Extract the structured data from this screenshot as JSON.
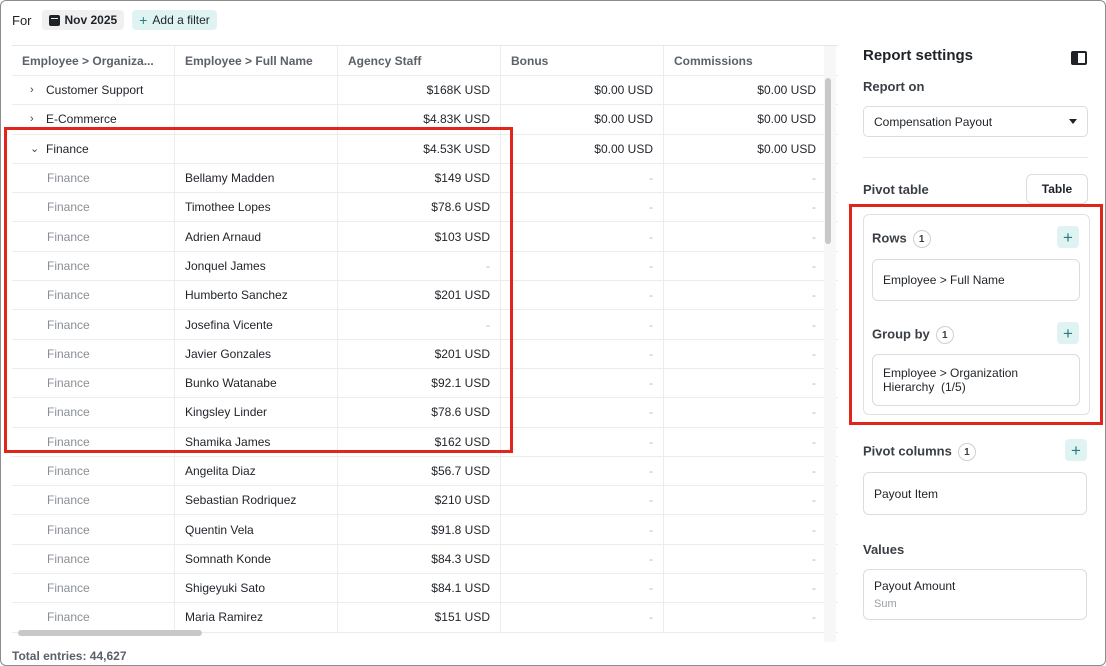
{
  "filter_bar": {
    "for_label": "For",
    "date": "Nov 2025",
    "add_filter": "Add a filter"
  },
  "table": {
    "columns": [
      "Employee > Organiza...",
      "Employee > Full Name",
      "Agency Staff",
      "Bonus",
      "Commissions"
    ],
    "rows": [
      {
        "kind": "group",
        "chevron": "›",
        "org": "Customer Support",
        "name": "",
        "agency": "$168K USD",
        "bonus": "$0.00 USD",
        "commissions": "$0.00 USD"
      },
      {
        "kind": "group",
        "chevron": "›",
        "org": "E-Commerce",
        "name": "",
        "agency": "$4.83K USD",
        "bonus": "$0.00 USD",
        "commissions": "$0.00 USD"
      },
      {
        "kind": "group",
        "chevron": "⌄",
        "org": "Finance",
        "name": "",
        "agency": "$4.53K USD",
        "bonus": "$0.00 USD",
        "commissions": "$0.00 USD"
      },
      {
        "kind": "item",
        "org": "Finance",
        "name": "Bellamy Madden",
        "agency": "$149 USD",
        "bonus": "-",
        "commissions": "-"
      },
      {
        "kind": "item",
        "org": "Finance",
        "name": "Timothee Lopes",
        "agency": "$78.6 USD",
        "bonus": "-",
        "commissions": "-"
      },
      {
        "kind": "item",
        "org": "Finance",
        "name": "Adrien Arnaud",
        "agency": "$103 USD",
        "bonus": "-",
        "commissions": "-"
      },
      {
        "kind": "item",
        "org": "Finance",
        "name": "Jonquel James",
        "agency": "-",
        "bonus": "-",
        "commissions": "-"
      },
      {
        "kind": "item",
        "org": "Finance",
        "name": "Humberto Sanchez",
        "agency": "$201 USD",
        "bonus": "-",
        "commissions": "-"
      },
      {
        "kind": "item",
        "org": "Finance",
        "name": "Josefina Vicente",
        "agency": "-",
        "bonus": "-",
        "commissions": "-"
      },
      {
        "kind": "item",
        "org": "Finance",
        "name": "Javier Gonzales",
        "agency": "$201 USD",
        "bonus": "-",
        "commissions": "-"
      },
      {
        "kind": "item",
        "org": "Finance",
        "name": "Bunko Watanabe",
        "agency": "$92.1 USD",
        "bonus": "-",
        "commissions": "-"
      },
      {
        "kind": "item",
        "org": "Finance",
        "name": "Kingsley Linder",
        "agency": "$78.6 USD",
        "bonus": "-",
        "commissions": "-"
      },
      {
        "kind": "item",
        "org": "Finance",
        "name": "Shamika James",
        "agency": "$162 USD",
        "bonus": "-",
        "commissions": "-"
      },
      {
        "kind": "item",
        "org": "Finance",
        "name": "Angelita Diaz",
        "agency": "$56.7 USD",
        "bonus": "-",
        "commissions": "-"
      },
      {
        "kind": "item",
        "org": "Finance",
        "name": "Sebastian Rodriquez",
        "agency": "$210 USD",
        "bonus": "-",
        "commissions": "-"
      },
      {
        "kind": "item",
        "org": "Finance",
        "name": "Quentin Vela",
        "agency": "$91.8 USD",
        "bonus": "-",
        "commissions": "-"
      },
      {
        "kind": "item",
        "org": "Finance",
        "name": "Somnath Konde",
        "agency": "$84.3 USD",
        "bonus": "-",
        "commissions": "-"
      },
      {
        "kind": "item",
        "org": "Finance",
        "name": "Shigeyuki Sato",
        "agency": "$84.1 USD",
        "bonus": "-",
        "commissions": "-"
      },
      {
        "kind": "item",
        "org": "Finance",
        "name": "Maria Ramirez",
        "agency": "$151 USD",
        "bonus": "-",
        "commissions": "-"
      }
    ],
    "total": "Total entries: 44,627"
  },
  "sidebar": {
    "title": "Report settings",
    "report_on_label": "Report on",
    "report_on_value": "Compensation Payout",
    "pivot_table_label": "Pivot table",
    "table_button": "Table",
    "rows_label": "Rows",
    "rows_count": "1",
    "rows_value": "Employee > Full Name",
    "group_by_label": "Group by",
    "group_by_count": "1",
    "group_by_value": "Employee > Organization Hierarchy  (1/5)",
    "pivot_columns_label": "Pivot columns",
    "pivot_columns_count": "1",
    "pivot_columns_value": "Payout Item",
    "values_label": "Values",
    "values_value": "Payout Amount",
    "values_sub": "Sum"
  },
  "colors": {
    "highlight": "#e1251b",
    "accent_bg": "#dff3f3"
  }
}
